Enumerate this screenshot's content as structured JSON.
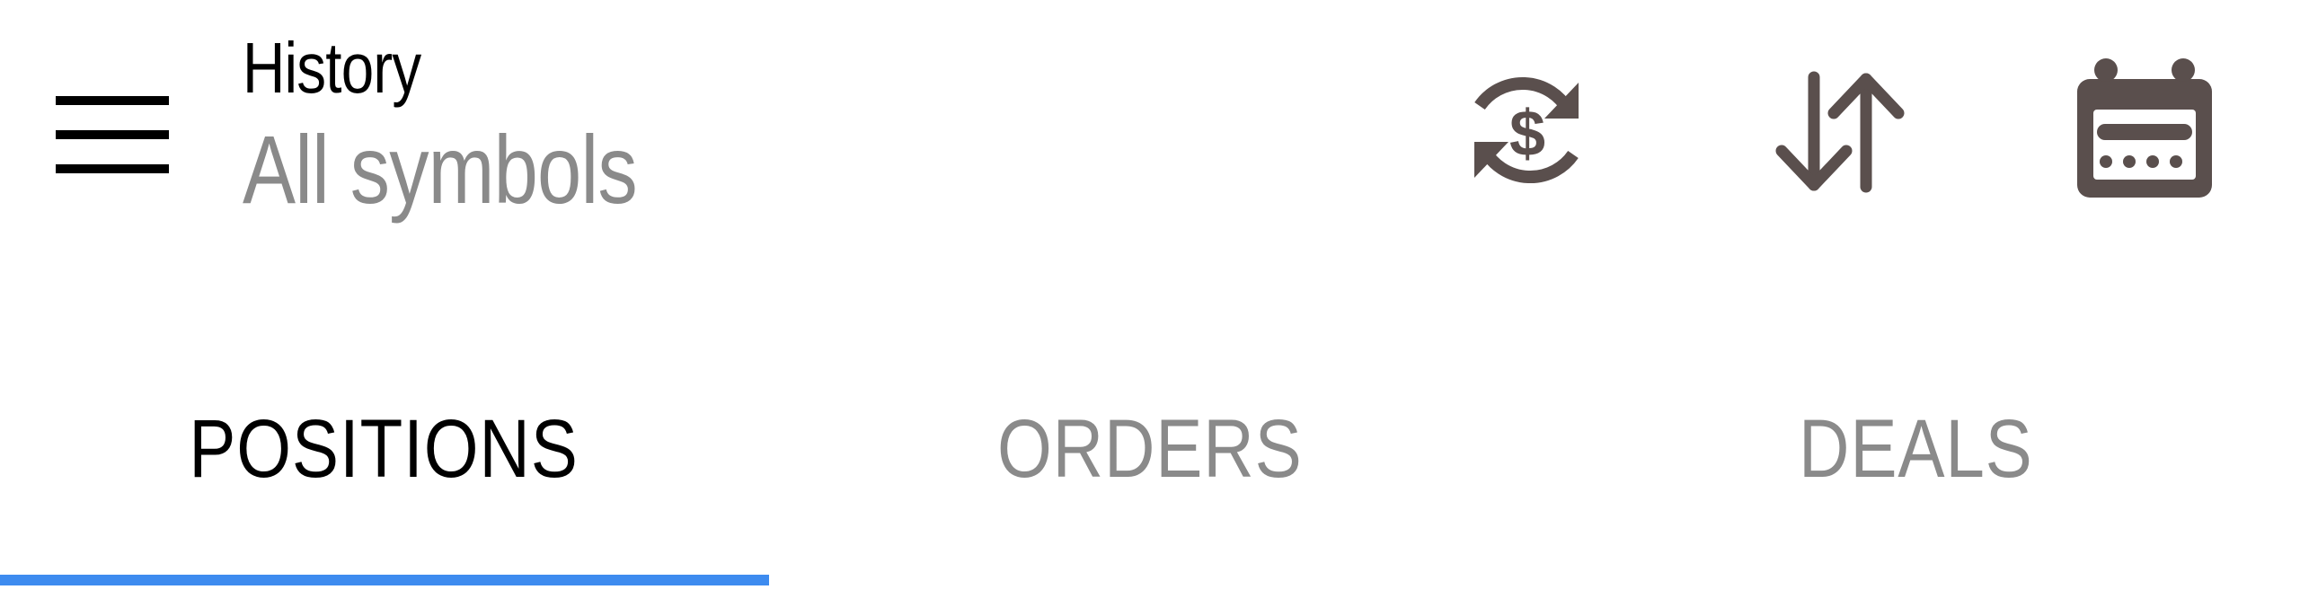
{
  "header": {
    "title": "History",
    "subtitle": "All symbols",
    "actions": [
      {
        "name": "currency-exchange-icon"
      },
      {
        "name": "sort-icon"
      },
      {
        "name": "calendar-icon"
      }
    ]
  },
  "tabs": [
    {
      "label": "POSITIONS",
      "active": true
    },
    {
      "label": "ORDERS",
      "active": false
    },
    {
      "label": "DEALS",
      "active": false
    }
  ],
  "colors": {
    "accent": "#3d8bef",
    "icon": "#5a4f4d",
    "text_primary": "#000000",
    "text_secondary": "#8a8a8a"
  }
}
